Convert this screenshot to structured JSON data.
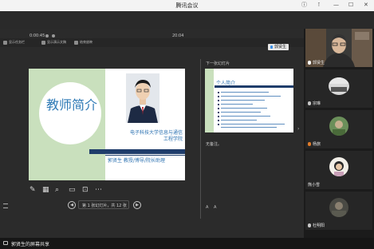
{
  "window": {
    "title": "腾讯会议"
  },
  "ppt_toolbar": {
    "buttons": [
      "显示任务栏",
      "显示演示文稿",
      "结束放映"
    ]
  },
  "presenter": {
    "elapsed": "0:00:45",
    "clock": "20:04",
    "next_slide_label": "下一张幻灯片",
    "notes": "无备注。",
    "nav_text": "第 1 张幻灯片，共 12 张"
  },
  "slide_current": {
    "title": "教师简介",
    "affiliation_line1": "电子科技大学信息与通信",
    "affiliation_line2": "工程学院",
    "name_line": "郭贤生 教授/博导/院长助理"
  },
  "slide_next": {
    "title": "个人简介"
  },
  "participants": [
    {
      "name": "郭贤生",
      "mic": "on",
      "kind": "camera"
    },
    {
      "name": "宗琳",
      "mic": "muted",
      "kind": "screen"
    },
    {
      "name": "杨旅",
      "mic": "muted",
      "kind": "avatar"
    },
    {
      "name": "熊小雪",
      "mic": "none",
      "kind": "avatar"
    },
    {
      "name": "杜明阳",
      "mic": "muted",
      "kind": "avatar"
    }
  ],
  "presenter_tag": "郭贤生",
  "share_status": "郭贤生的屏幕共享",
  "colors": {
    "accent_green": "#c9e0bd",
    "slide_blue": "#2e73b2",
    "slide_navy": "#1f3d6b"
  }
}
